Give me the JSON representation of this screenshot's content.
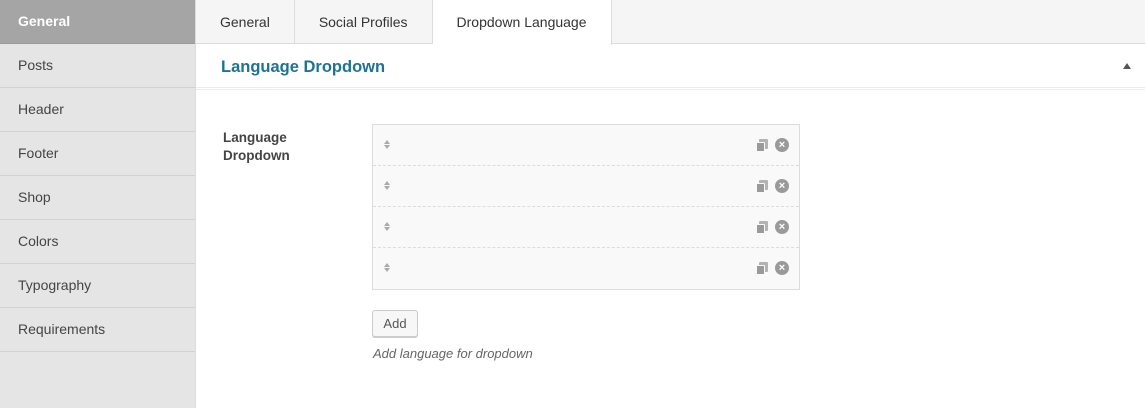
{
  "sidebar": {
    "items": [
      {
        "label": "General",
        "active": true
      },
      {
        "label": "Posts"
      },
      {
        "label": "Header"
      },
      {
        "label": "Footer"
      },
      {
        "label": "Shop"
      },
      {
        "label": "Colors"
      },
      {
        "label": "Typography"
      },
      {
        "label": "Requirements"
      }
    ]
  },
  "tabs": [
    {
      "label": "General"
    },
    {
      "label": "Social Profiles"
    },
    {
      "label": "Dropdown Language",
      "active": true
    }
  ],
  "section": {
    "title": "Language Dropdown",
    "collapse_icon": "triangle-up-icon"
  },
  "field": {
    "label": "Language Dropdown",
    "rows": [
      {
        "value": ""
      },
      {
        "value": ""
      },
      {
        "value": ""
      },
      {
        "value": ""
      }
    ],
    "row_icons": {
      "handle": "sort-handle-icon",
      "copy": "copy-icon",
      "remove": "remove-icon",
      "remove_glyph": "×"
    },
    "add_label": "Add",
    "description": "Add language for dropdown"
  },
  "colors": {
    "accent": "#1e7395",
    "sidebar_bg": "#e5e5e5",
    "sidebar_active_bg": "#a5a5a5"
  }
}
